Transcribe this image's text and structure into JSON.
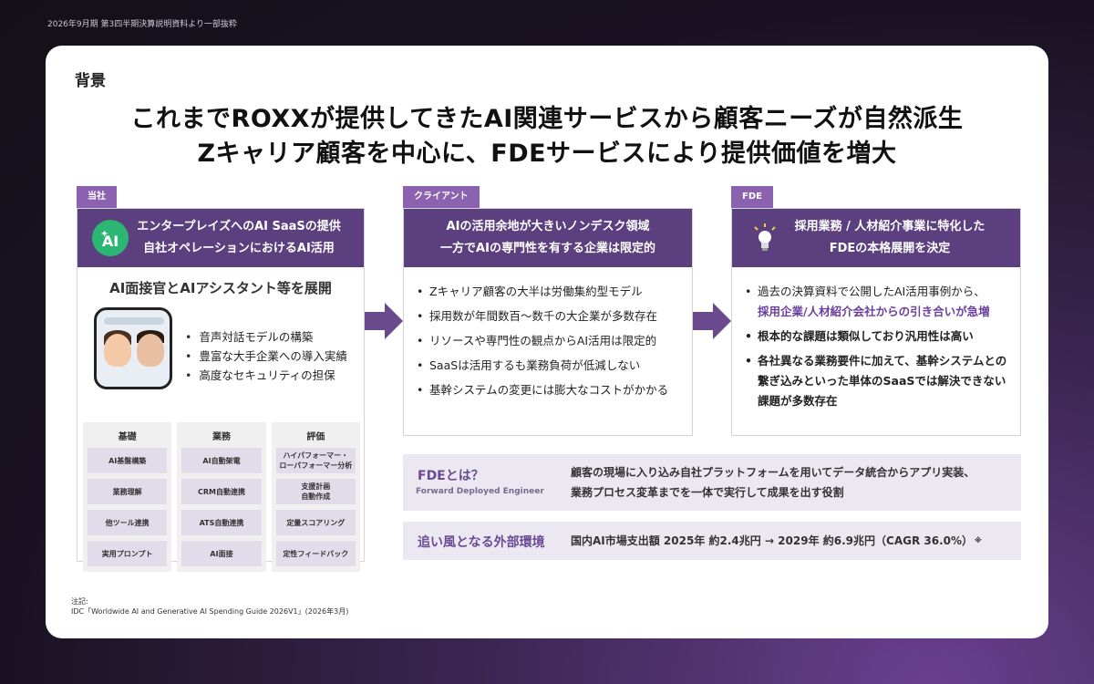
{
  "header_note": "2026年9月期 第3四半期決算説明資料より一部抜粋",
  "section_label": "背景",
  "headline": {
    "line1": "これまでROXXが提供してきたAI関連サービスから顧客ニーズが自然派生",
    "line2": "Zキャリア顧客を中心に、FDEサービスにより提供価値を増大"
  },
  "col1": {
    "tag": "当社",
    "icon": "ai-sparkle-badge-icon",
    "badge_text": "AI",
    "head_line1": "エンタープレイズへのAI SaaSの提供",
    "head_line2": "自社オペレーションにおけるAI活用",
    "subtitle": "AI面接官とAIアシスタント等を展開",
    "features": [
      "音声対話モデルの構築",
      "豊富な大手企業への導入実績",
      "高度なセキュリティの担保"
    ],
    "grid": [
      {
        "title": "基礎",
        "cells": [
          "AI基盤構築",
          "業務理解",
          "他ツール連携",
          "実用プロンプト"
        ]
      },
      {
        "title": "業務",
        "cells": [
          "AI自動架電",
          "CRM自動連携",
          "ATS自動連携",
          "AI面接"
        ]
      },
      {
        "title": "評価",
        "cells": [
          "ハイパフォーマー・\nローパフォーマー分析",
          "支援計画\n自動作成",
          "定量スコアリング",
          "定性フィードバック"
        ]
      }
    ]
  },
  "col2": {
    "tag": "クライアント",
    "head_line1": "AIの活用余地が大きいノンデスク領域",
    "head_line2": "一方でAIの専門性を有する企業は限定的",
    "bullets": [
      "Zキャリア顧客の大半は労働集約型モデル",
      "採用数が年間数百〜数千の大企業が多数存在",
      "リソースや専門性の観点からAI活用は限定的",
      "SaaSは活用するも業務負荷が低減しない",
      "基幹システムの変更には膨大なコストがかかる"
    ]
  },
  "col3": {
    "tag": "FDE",
    "icon": "lightbulb-icon",
    "head_line1": "採用業務 / 人材紹介事業に特化した",
    "head_line2": "FDEの本格展開を決定",
    "b1_pre": "過去の決算資料で公開したAI活用事例から、",
    "b1_hl": "採用企業/人材紹介会社からの引き合いが急増",
    "b2": "根本的な課題は類似しており汎用性は高い",
    "b3": "各社異なる業務要件に加えて、基幹システムとの繋ぎ込みといった単体のSaaSでは解決できない課題が多数存在"
  },
  "fde_box": {
    "title": "FDEとは？",
    "subtitle": "Forward Deployed Engineer",
    "line1": "顧客の現場に入り込み自社プラットフォームを用いてデータ統合からアプリ実装、",
    "line2": "業務プロセス変革までを一体で実行して成果を出す役割"
  },
  "env_box": {
    "title": "追い風となる外部環境",
    "body": "国内AI市場支出額 2025年 約2.4兆円 → 2029年 約6.9兆円（CAGR 36.0%）",
    "mark": "※"
  },
  "note": {
    "label": "注記:",
    "source": "IDC「Worldwide AI and Generative AI Spending Guide 2026V1」(2026年3月)"
  },
  "colors": {
    "accent": "#5c3f7e",
    "tag": "#8b62b0",
    "highlight": "#6b3fa0",
    "badge_green": "#2bb673"
  }
}
